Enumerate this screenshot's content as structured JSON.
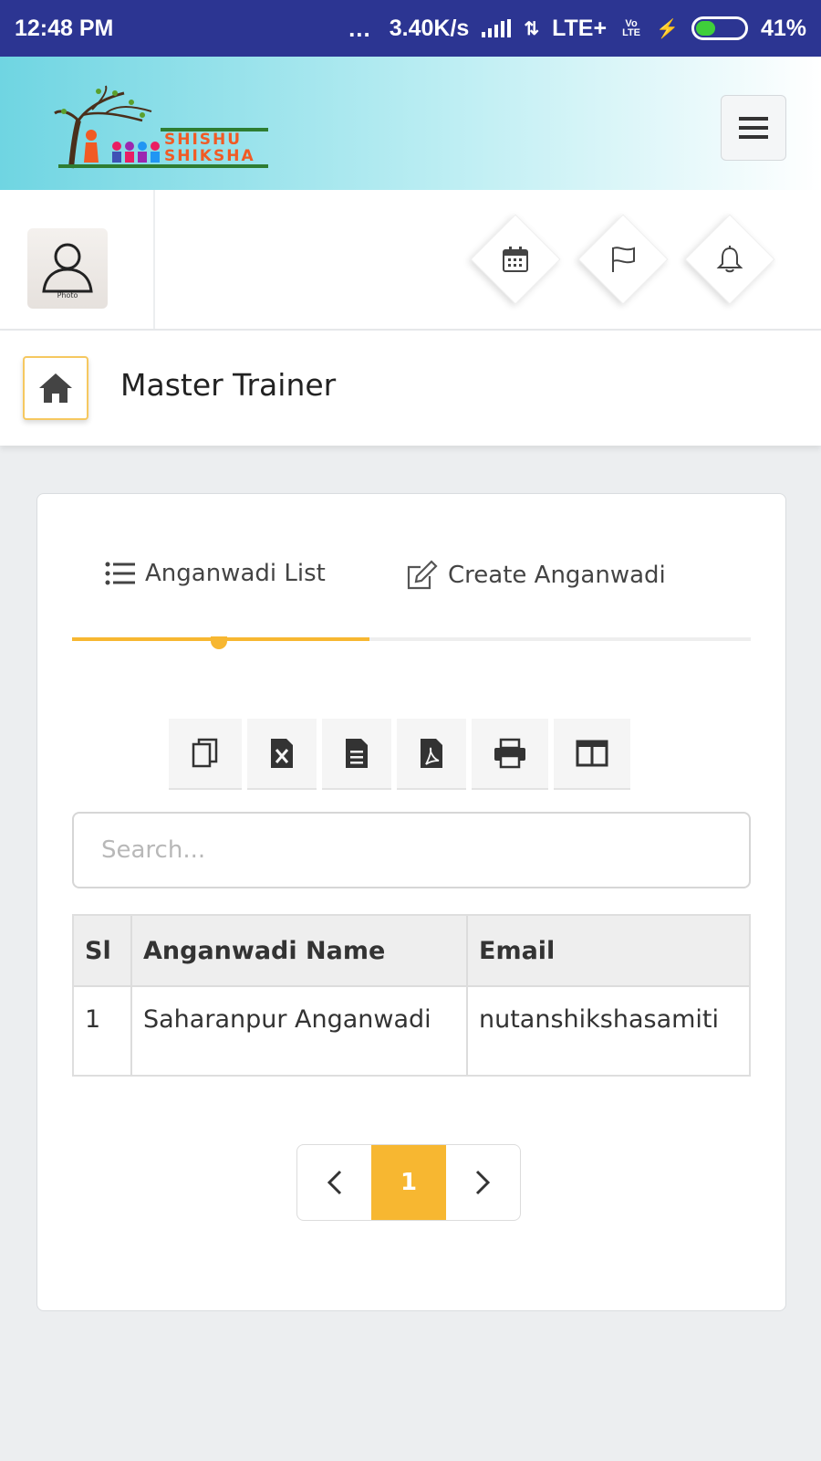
{
  "status_bar": {
    "time": "12:48 PM",
    "dots": "...",
    "speed": "3.40K/s",
    "network": "LTE+",
    "volte": "Vo LTE",
    "battery": "41%",
    "battery_level": 0.41
  },
  "header": {
    "logo_line1": "SHISHU",
    "logo_line2": "SHIKSHA",
    "menu_icon": "hamburger-icon"
  },
  "profile": {
    "avatar_caption": "Photo",
    "actions": [
      "calendar-icon",
      "flag-icon",
      "bell-icon"
    ]
  },
  "breadcrumb": {
    "home_icon": "home-icon",
    "title": "Master Trainer"
  },
  "tabs": [
    {
      "label": "Anganwadi List",
      "icon": "list-icon",
      "active": true
    },
    {
      "label": "Create Anganwadi",
      "icon": "edit-icon",
      "active": false
    }
  ],
  "toolbar": [
    "copy-icon",
    "excel-icon",
    "csv-icon",
    "pdf-icon",
    "print-icon",
    "columns-icon"
  ],
  "search": {
    "placeholder": "Search...",
    "value": ""
  },
  "table": {
    "headers": [
      "Sl",
      "Anganwadi Name",
      "Email"
    ],
    "rows": [
      [
        "1",
        "Saharanpur Anganwadi",
        "nutanshikshasamiti"
      ]
    ]
  },
  "pagination": {
    "prev": "‹",
    "current": "1",
    "next": "›"
  },
  "colors": {
    "accent": "#f7b731",
    "status_bar": "#2c3592",
    "header_start": "#6fd5e2"
  }
}
